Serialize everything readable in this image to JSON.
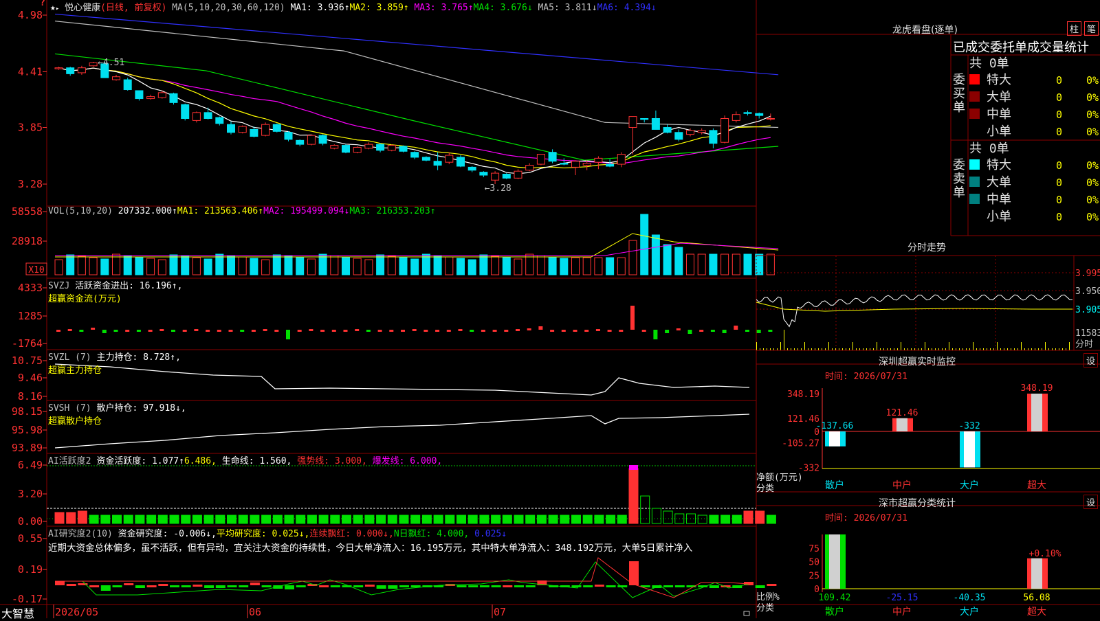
{
  "colors": {
    "up": "#ff3232",
    "down": "#00e0f0",
    "bg": "#000000",
    "grid": "#8b0000",
    "ma1": "#ffffff",
    "ma2": "#ffff00",
    "ma3": "#ff00ff",
    "ma4": "#00e000",
    "ma5": "#c0c0c0",
    "ma6": "#3030ff"
  },
  "kline": {
    "stock_name": "悦心健康",
    "period": "(日线, 前复权)",
    "ma_params": "MA(5,10,20,30,60,120)",
    "ma1": "MA1: 3.936↑",
    "ma2": "MA2: 3.859↑",
    "ma3": "MA3: 3.765↑",
    "ma4": "MA4: 3.676↓",
    "ma5": "MA5: 3.811↓",
    "ma6": "MA6: 4.394↓",
    "high_label": "←4.51",
    "low_label": "←3.28",
    "y_ticks": [
      "4.98",
      "4.41",
      "3.85",
      "3.28"
    ],
    "top_icon": "?"
  },
  "vol": {
    "title": "VOL(5,10,20)",
    "value": "207332.000↑",
    "ma1": "MA1: 213563.406↑",
    "ma2": "MA2: 195499.094↓",
    "ma3": "MA3: 216353.203↑",
    "y_ticks": [
      "58558",
      "28918"
    ],
    "unit": "X10"
  },
  "svzj": {
    "title": "SVZJ",
    "text": "活跃资金进出: 16.196↑,",
    "sub": "超赢资金流(万元)",
    "y_ticks": [
      "4333",
      "1285",
      "-1764"
    ]
  },
  "svzl": {
    "title": "SVZL (7)",
    "text": "主力持仓: 8.728↑,",
    "sub": "超赢主力持仓",
    "y_ticks": [
      "10.75",
      "9.46",
      "8.16"
    ]
  },
  "svsh": {
    "title": "SVSH (7)",
    "text": "散户持仓: 97.918↓,",
    "sub": "超赢散户持仓",
    "y_ticks": [
      "98.15",
      "95.98",
      "93.89"
    ]
  },
  "ai1": {
    "title": "AI活跃度2",
    "t1": "资金活跃度: 1.077↑",
    "t2": "6.486,",
    "t3": "生命线: 1.560,",
    "t4": "强势线: 3.000,",
    "t5": "爆发线: 6.000,",
    "y_ticks": [
      "6.49",
      "3.20",
      "0.00"
    ]
  },
  "ai2": {
    "title": "AI研究度2(10)",
    "t1": "资金研究度: -0.006↓,",
    "t2": "平均研究度: 0.025↓,",
    "t3": "连续飘红: 0.000↓,",
    "t4": "N日飘红: 4.000,",
    "t5": "0.025↓",
    "comment": "近期大资金总体偏多，虽不活跃，但有异动，宜关注大资金的持续性，今日大单净流入：16.195万元，其中特大单净流入：348.192万元，大单5日累计净入",
    "y_ticks": [
      "0.55",
      "0.19",
      "-0.17"
    ]
  },
  "xaxis": {
    "labels": [
      "2026/05",
      "06",
      "07"
    ],
    "brand": "大智慧"
  },
  "dragon": {
    "title": "龙虎看盘(逐单)",
    "btn1": "柱",
    "btn2": "笔",
    "subtitle": "已成交委托单成交量统计",
    "buy_label": "委买单",
    "sell_label": "委卖单",
    "buy_total": "共 0单",
    "sell_total": "共 0单",
    "buy_rows": [
      {
        "name": "特大",
        "v": "0",
        "p": "0%"
      },
      {
        "name": "大单",
        "v": "0",
        "p": "0%"
      },
      {
        "name": "中单",
        "v": "0",
        "p": "0%"
      },
      {
        "name": "小单",
        "v": "0",
        "p": "0%"
      }
    ],
    "sell_rows": [
      {
        "name": "特大",
        "v": "0",
        "p": "0%"
      },
      {
        "name": "大单",
        "v": "0",
        "p": "0%"
      },
      {
        "name": "中单",
        "v": "0",
        "p": "0%"
      },
      {
        "name": "小单",
        "v": "0",
        "p": "0%"
      }
    ]
  },
  "intraday": {
    "title": "分时走势",
    "y_labels": [
      "3.995",
      "3.950",
      "3.905"
    ],
    "vol_label": "11583",
    "vol_unit": "分时"
  },
  "monitor": {
    "title": "深圳超赢实时监控",
    "btn": "设",
    "time": "时间: 2026/07/31",
    "unit": "净额(万元)",
    "cat": "分类",
    "y_ticks": [
      "348.19",
      "121.46",
      "0",
      "-105.27",
      "-332"
    ],
    "categories": [
      "散户",
      "中户",
      "大户",
      "超大"
    ],
    "values": [
      -137.66,
      121.46,
      -332,
      348.19
    ],
    "labels": [
      "-137.66",
      "121.46",
      "-332",
      "348.19"
    ]
  },
  "classify": {
    "title": "深市超赢分类统计",
    "btn": "设",
    "time": "时间: 2026/07/31",
    "unit": "比例%",
    "cat": "分类",
    "y_ticks": [
      "75",
      "50",
      "25",
      "0"
    ],
    "categories": [
      "散户",
      "中户",
      "大户",
      "超大"
    ],
    "values": [
      109.42,
      -25.15,
      -40.35,
      56.08
    ],
    "labels": [
      "109.42",
      "-25.15",
      "-40.35",
      "56.08"
    ],
    "extra": "+0.10%"
  },
  "chart_data": {
    "type": "candlestick",
    "title": "悦心健康 (日线, 前复权)",
    "x_range": [
      "2026/05",
      "2026/07/31"
    ],
    "ylim": [
      3.2,
      5.0
    ],
    "candles": [
      [
        4.44,
        4.46,
        4.43,
        4.45
      ],
      [
        4.45,
        4.46,
        4.37,
        4.39
      ],
      [
        4.4,
        4.47,
        4.38,
        4.45
      ],
      [
        4.47,
        4.51,
        4.46,
        4.5
      ],
      [
        4.49,
        4.51,
        4.43,
        4.35
      ],
      [
        4.33,
        4.38,
        4.32,
        4.36
      ],
      [
        4.33,
        4.35,
        4.22,
        4.23
      ],
      [
        4.22,
        4.22,
        4.12,
        4.14
      ],
      [
        4.14,
        4.18,
        4.13,
        4.16
      ],
      [
        4.15,
        4.22,
        4.14,
        4.2
      ],
      [
        4.19,
        4.2,
        4.08,
        4.1
      ],
      [
        4.08,
        4.09,
        3.92,
        3.94
      ],
      [
        3.92,
        4.01,
        3.9,
        4.0
      ],
      [
        4.0,
        4.05,
        3.93,
        3.94
      ],
      [
        3.95,
        3.96,
        3.87,
        3.89
      ],
      [
        3.88,
        3.91,
        3.78,
        3.8
      ],
      [
        3.8,
        3.87,
        3.79,
        3.86
      ],
      [
        3.83,
        3.86,
        3.75,
        3.76
      ],
      [
        3.77,
        3.9,
        3.76,
        3.88
      ],
      [
        3.88,
        3.89,
        3.8,
        3.81
      ],
      [
        3.8,
        3.81,
        3.71,
        3.73
      ],
      [
        3.72,
        3.73,
        3.66,
        3.68
      ],
      [
        3.68,
        3.78,
        3.67,
        3.77
      ],
      [
        3.77,
        3.78,
        3.67,
        3.69
      ],
      [
        3.64,
        3.68,
        3.63,
        3.67
      ],
      [
        3.67,
        3.68,
        3.59,
        3.6
      ],
      [
        3.6,
        3.66,
        3.59,
        3.65
      ],
      [
        3.64,
        3.7,
        3.63,
        3.68
      ],
      [
        3.68,
        3.69,
        3.6,
        3.62
      ],
      [
        3.62,
        3.68,
        3.61,
        3.67
      ],
      [
        3.66,
        3.67,
        3.6,
        3.61
      ],
      [
        3.6,
        3.61,
        3.53,
        3.55
      ],
      [
        3.55,
        3.56,
        3.51,
        3.52
      ],
      [
        3.51,
        3.6,
        3.42,
        3.47
      ],
      [
        3.5,
        3.6,
        3.48,
        3.57
      ],
      [
        3.55,
        3.57,
        3.45,
        3.46
      ],
      [
        3.45,
        3.46,
        3.4,
        3.42
      ],
      [
        3.4,
        3.41,
        3.35,
        3.37
      ],
      [
        3.32,
        3.41,
        3.28,
        3.39
      ],
      [
        3.38,
        3.39,
        3.33,
        3.34
      ],
      [
        3.34,
        3.43,
        3.33,
        3.41
      ],
      [
        3.42,
        3.49,
        3.41,
        3.47
      ],
      [
        3.48,
        3.58,
        3.47,
        3.58
      ],
      [
        3.6,
        3.63,
        3.49,
        3.51
      ],
      [
        3.49,
        3.54,
        3.47,
        3.48
      ],
      [
        3.45,
        3.52,
        3.37,
        3.51
      ],
      [
        3.47,
        3.52,
        3.42,
        3.49
      ],
      [
        3.5,
        3.56,
        3.43,
        3.54
      ],
      [
        3.48,
        3.53,
        3.45,
        3.46
      ],
      [
        3.48,
        3.6,
        3.45,
        3.58
      ],
      [
        3.85,
        3.93,
        3.58,
        3.96
      ],
      [
        3.94,
        3.94,
        3.9,
        3.93
      ],
      [
        3.94,
        4.02,
        3.88,
        3.83
      ],
      [
        3.85,
        3.88,
        3.79,
        3.8
      ],
      [
        3.8,
        3.83,
        3.71,
        3.73
      ],
      [
        3.78,
        3.84,
        3.76,
        3.82
      ],
      [
        3.8,
        3.84,
        3.78,
        3.82
      ],
      [
        3.82,
        3.84,
        3.64,
        3.69
      ],
      [
        3.7,
        3.97,
        3.69,
        3.94
      ],
      [
        3.92,
        4.01,
        3.9,
        3.98
      ],
      [
        4.0,
        4.02,
        3.97,
        3.99
      ],
      [
        3.99,
        4.0,
        3.94,
        3.97
      ],
      [
        3.94,
        3.99,
        3.92,
        3.94
      ]
    ]
  }
}
